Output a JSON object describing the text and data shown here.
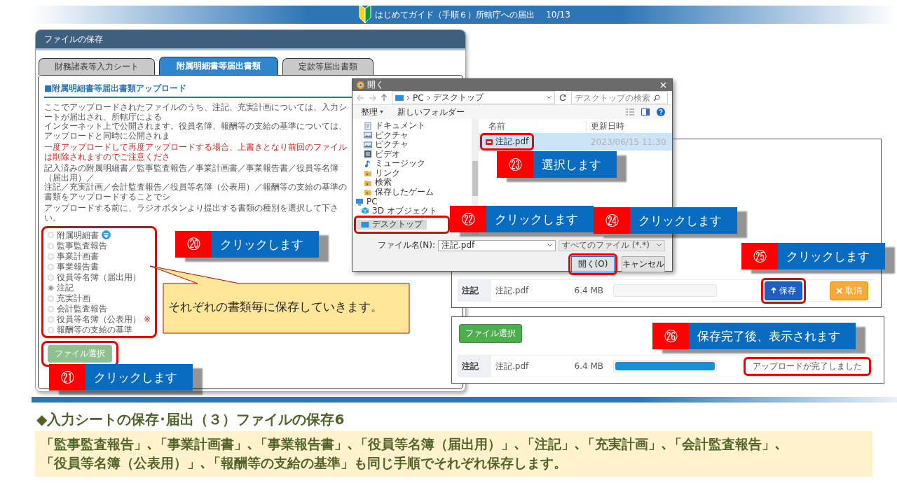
{
  "header": {
    "title": "はじめてガイド（手順６）所轄庁への届出",
    "page": "10/13"
  },
  "main_window": {
    "title": "ファイルの保存",
    "tabs": [
      {
        "label": "財務諸表等入力シート",
        "selected": false
      },
      {
        "label": "附属明細書等届出書類",
        "selected": true
      },
      {
        "label": "定款等届出書類",
        "selected": false
      }
    ],
    "heading": "■附属明細書等届出書類アップロード",
    "paragraphs": [
      {
        "kind": "info",
        "lines": [
          "ここでアップロードされたファイルのうち、注記、充実計画については、入力シートが届出され、所轄庁による",
          "インターネット上で公開されます。役員名簿、報酬等の支給の基準については、アップロードと同時に公開されま"
        ]
      },
      {
        "kind": "warning",
        "lines": [
          "一度アップロードして再度アップロードする場合、上書きとなり前回のファイルは削除されますのでご注意くださ"
        ]
      },
      {
        "kind": "info",
        "lines": [
          "記入済みの附属明細書／監事監査報告／事業計画書／事業報告書／役員等名簿（届出用）／",
          "注記／充実計画／会計監査報告／役員等名簿（公表用）／報酬等の支給の基準の書類をアップロードすることでシ"
        ]
      },
      {
        "kind": "info",
        "lines": [
          "アップロードする前に、ラジオボタンより提出する書類の種別を選択して下さい。"
        ]
      }
    ],
    "document_types": [
      {
        "label": "附属明細書",
        "selected": false,
        "help_icon": true
      },
      {
        "label": "監事監査報告",
        "selected": false,
        "help_icon": false
      },
      {
        "label": "事業計画書",
        "selected": false,
        "help_icon": false
      },
      {
        "label": "事業報告書",
        "selected": false,
        "help_icon": false
      },
      {
        "label": "役員等名簿（届出用）",
        "selected": false,
        "help_icon": false
      },
      {
        "label": "注記",
        "selected": true,
        "help_icon": false
      },
      {
        "label": "充実計画",
        "selected": false,
        "help_icon": false
      },
      {
        "label": "会計監査報告",
        "selected": false,
        "help_icon": false
      },
      {
        "label": "役員等名簿（公表用）",
        "selected": false,
        "help_icon": false,
        "note": "※"
      },
      {
        "label": "報酬等の支給の基準",
        "selected": false,
        "help_icon": false
      }
    ],
    "file_button": {
      "label": "ファイル選択",
      "disabled": true
    }
  },
  "dialog": {
    "title": "開く",
    "path": [
      "PC",
      "デスクトップ"
    ],
    "search_placeholder": "デスクトップの検索",
    "toolbar": [
      "整理",
      "新しいフォルダー"
    ],
    "tree": [
      {
        "label": "ドキュメント",
        "kind": "document",
        "selected": false
      },
      {
        "label": "ピクチャ",
        "kind": "picture",
        "selected": false
      },
      {
        "label": "ピクチャ",
        "kind": "picture",
        "selected": false
      },
      {
        "label": "ビデオ",
        "kind": "video",
        "selected": false
      },
      {
        "label": "ミュージック",
        "kind": "music",
        "selected": false
      },
      {
        "label": "リンク",
        "kind": "folder",
        "selected": false
      },
      {
        "label": "検索",
        "kind": "folder",
        "selected": false
      },
      {
        "label": "保存したゲーム",
        "kind": "folder",
        "selected": false
      },
      {
        "label": "PC",
        "kind": "pc",
        "selected": false,
        "children": [
          {
            "label": "3D オブジェクト",
            "kind": "cube",
            "selected": false
          },
          {
            "label": "デスクトップ",
            "kind": "desktop",
            "selected": true
          }
        ]
      }
    ],
    "columns": [
      "名前",
      "更新日時"
    ],
    "files": [
      {
        "name": "注記.pdf",
        "modified": "2023/06/15 11:30",
        "selected": true
      }
    ],
    "file_name_label": "ファイル名(N):",
    "file_name": "注記.pdf",
    "file_type": "すべてのファイル (*.*)",
    "buttons": [
      {
        "label": "開く(O)",
        "kind": "primary"
      },
      {
        "label": "キャンセル",
        "kind": "secondary"
      }
    ]
  },
  "upload_panels": [
    {
      "kind": "pending",
      "row": {
        "label": "注記",
        "file": "注記.pdf",
        "size": "6.4 MB",
        "level": 0
      },
      "buttons": [
        {
          "label": "保存",
          "kind": "save"
        },
        {
          "label": "取消",
          "kind": "cancel"
        }
      ]
    },
    {
      "kind": "done",
      "file_button": {
        "label": "ファイル選択",
        "disabled": false
      },
      "row": {
        "label": "注記",
        "file": "注記.pdf",
        "size": "6.4 MB",
        "level": 1
      },
      "status": "アップロードが完了しました"
    }
  ],
  "callouts": [
    {
      "number": "⑳",
      "text": "クリックします"
    },
    {
      "number": "㉑",
      "text": "クリックします"
    },
    {
      "number": "㉓",
      "text": "選択します"
    },
    {
      "number": "㉒",
      "text": "クリックします"
    },
    {
      "number": "㉔",
      "text": "クリックします"
    },
    {
      "number": "㉕",
      "text": "クリックします"
    },
    {
      "number": "㉖",
      "text": "保存完了後、表示されます"
    }
  ],
  "bubble": "それぞれの書類毎に保存していきます。",
  "summary": {
    "heading": "◆入力シートの保存･届出（３）ファイルの保存6",
    "lines": [
      "「監事監査報告」､「事業計画書」､「事業報告書」､「役員等名簿（届出用）」､「注記」､「充実計画」､「会計監査報告」､",
      "「役員等名簿（公表用）」､「報酬等の支給の基準」も同じ手順でそれぞれ保存します。"
    ]
  }
}
